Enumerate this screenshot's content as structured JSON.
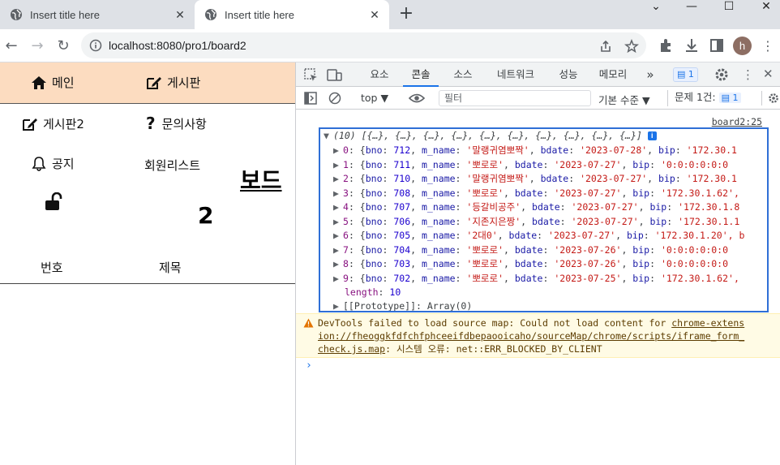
{
  "browser": {
    "tabs": [
      {
        "title": "Insert title here",
        "active": false
      },
      {
        "title": "Insert title here",
        "active": true
      }
    ],
    "url": "localhost:8080/pro1/board2",
    "profile_initial": "h"
  },
  "page": {
    "menu": {
      "main": "메인",
      "board": "게시판",
      "board2": "게시판2",
      "inquiry": "문의사항",
      "notice": "공지",
      "member_list": "회원리스트"
    },
    "board_title": "보드",
    "board_number": "2",
    "columns": {
      "number": "번호",
      "subject": "제목"
    }
  },
  "devtools": {
    "tabs": [
      "요소",
      "콘솔",
      "소스",
      "네트워크",
      "성능",
      "메모리"
    ],
    "active_tab": "콘솔",
    "issues_badge": "1",
    "context": "top",
    "filter_placeholder": "필터",
    "level": "기본 수준",
    "issues_label": "문제 1건:",
    "issues_count": "1",
    "source_link": "board2:25",
    "array_summary": "(10) [{…}, {…}, {…}, {…}, {…}, {…}, {…}, {…}, {…}, {…}]",
    "rows": [
      {
        "idx": "0",
        "bno": "712",
        "m_name": "'말랭귀염뽀짝'",
        "bdate": "'2023-07-28'",
        "bip": "'172.30.1"
      },
      {
        "idx": "1",
        "bno": "711",
        "m_name": "'뽀로로'",
        "bdate": "'2023-07-27'",
        "bip": "'0:0:0:0:0:0"
      },
      {
        "idx": "2",
        "bno": "710",
        "m_name": "'말랭귀염뽀짝'",
        "bdate": "'2023-07-27'",
        "bip": "'172.30.1"
      },
      {
        "idx": "3",
        "bno": "708",
        "m_name": "'뽀로로'",
        "bdate": "'2023-07-27'",
        "bip": "'172.30.1.62',"
      },
      {
        "idx": "4",
        "bno": "707",
        "m_name": "'등갈비공주'",
        "bdate": "'2023-07-27'",
        "bip": "'172.30.1.8"
      },
      {
        "idx": "5",
        "bno": "706",
        "m_name": "'지존지은짱'",
        "bdate": "'2023-07-27'",
        "bip": "'172.30.1.1"
      },
      {
        "idx": "6",
        "bno": "705",
        "m_name": "'2대0'",
        "bdate": "'2023-07-27'",
        "bip": "'172.30.1.20', b"
      },
      {
        "idx": "7",
        "bno": "704",
        "m_name": "'뽀로로'",
        "bdate": "'2023-07-26'",
        "bip": "'0:0:0:0:0:0"
      },
      {
        "idx": "8",
        "bno": "703",
        "m_name": "'뽀로로'",
        "bdate": "'2023-07-26'",
        "bip": "'0:0:0:0:0:0"
      },
      {
        "idx": "9",
        "bno": "702",
        "m_name": "'뽀로로'",
        "bdate": "'2023-07-25'",
        "bip": "'172.30.1.62',"
      }
    ],
    "length_label": "length",
    "length_value": "10",
    "prototype": "[[Prototype]]: Array(0)",
    "warning": {
      "line1_text": "DevTools failed to load source map: Could not load content for ",
      "line1_link": "chrome-extens",
      "line2_link": "ion://fheoggkfdfchfphceeifdbepaooicaho/sourceMap/chrome/scripts/iframe_form_",
      "line3_link": "check.js.map",
      "line3_text": ": 시스템 오류: net::ERR_BLOCKED_BY_CLIENT"
    },
    "prompt": "›",
    "colors": {
      "accent": "#1a73e8",
      "string": "#c41a16",
      "number": "#1c00cf",
      "key": "#1a1aa6",
      "warning_bg": "#fffbe5",
      "menu_bg": "#fcdcc0"
    }
  }
}
